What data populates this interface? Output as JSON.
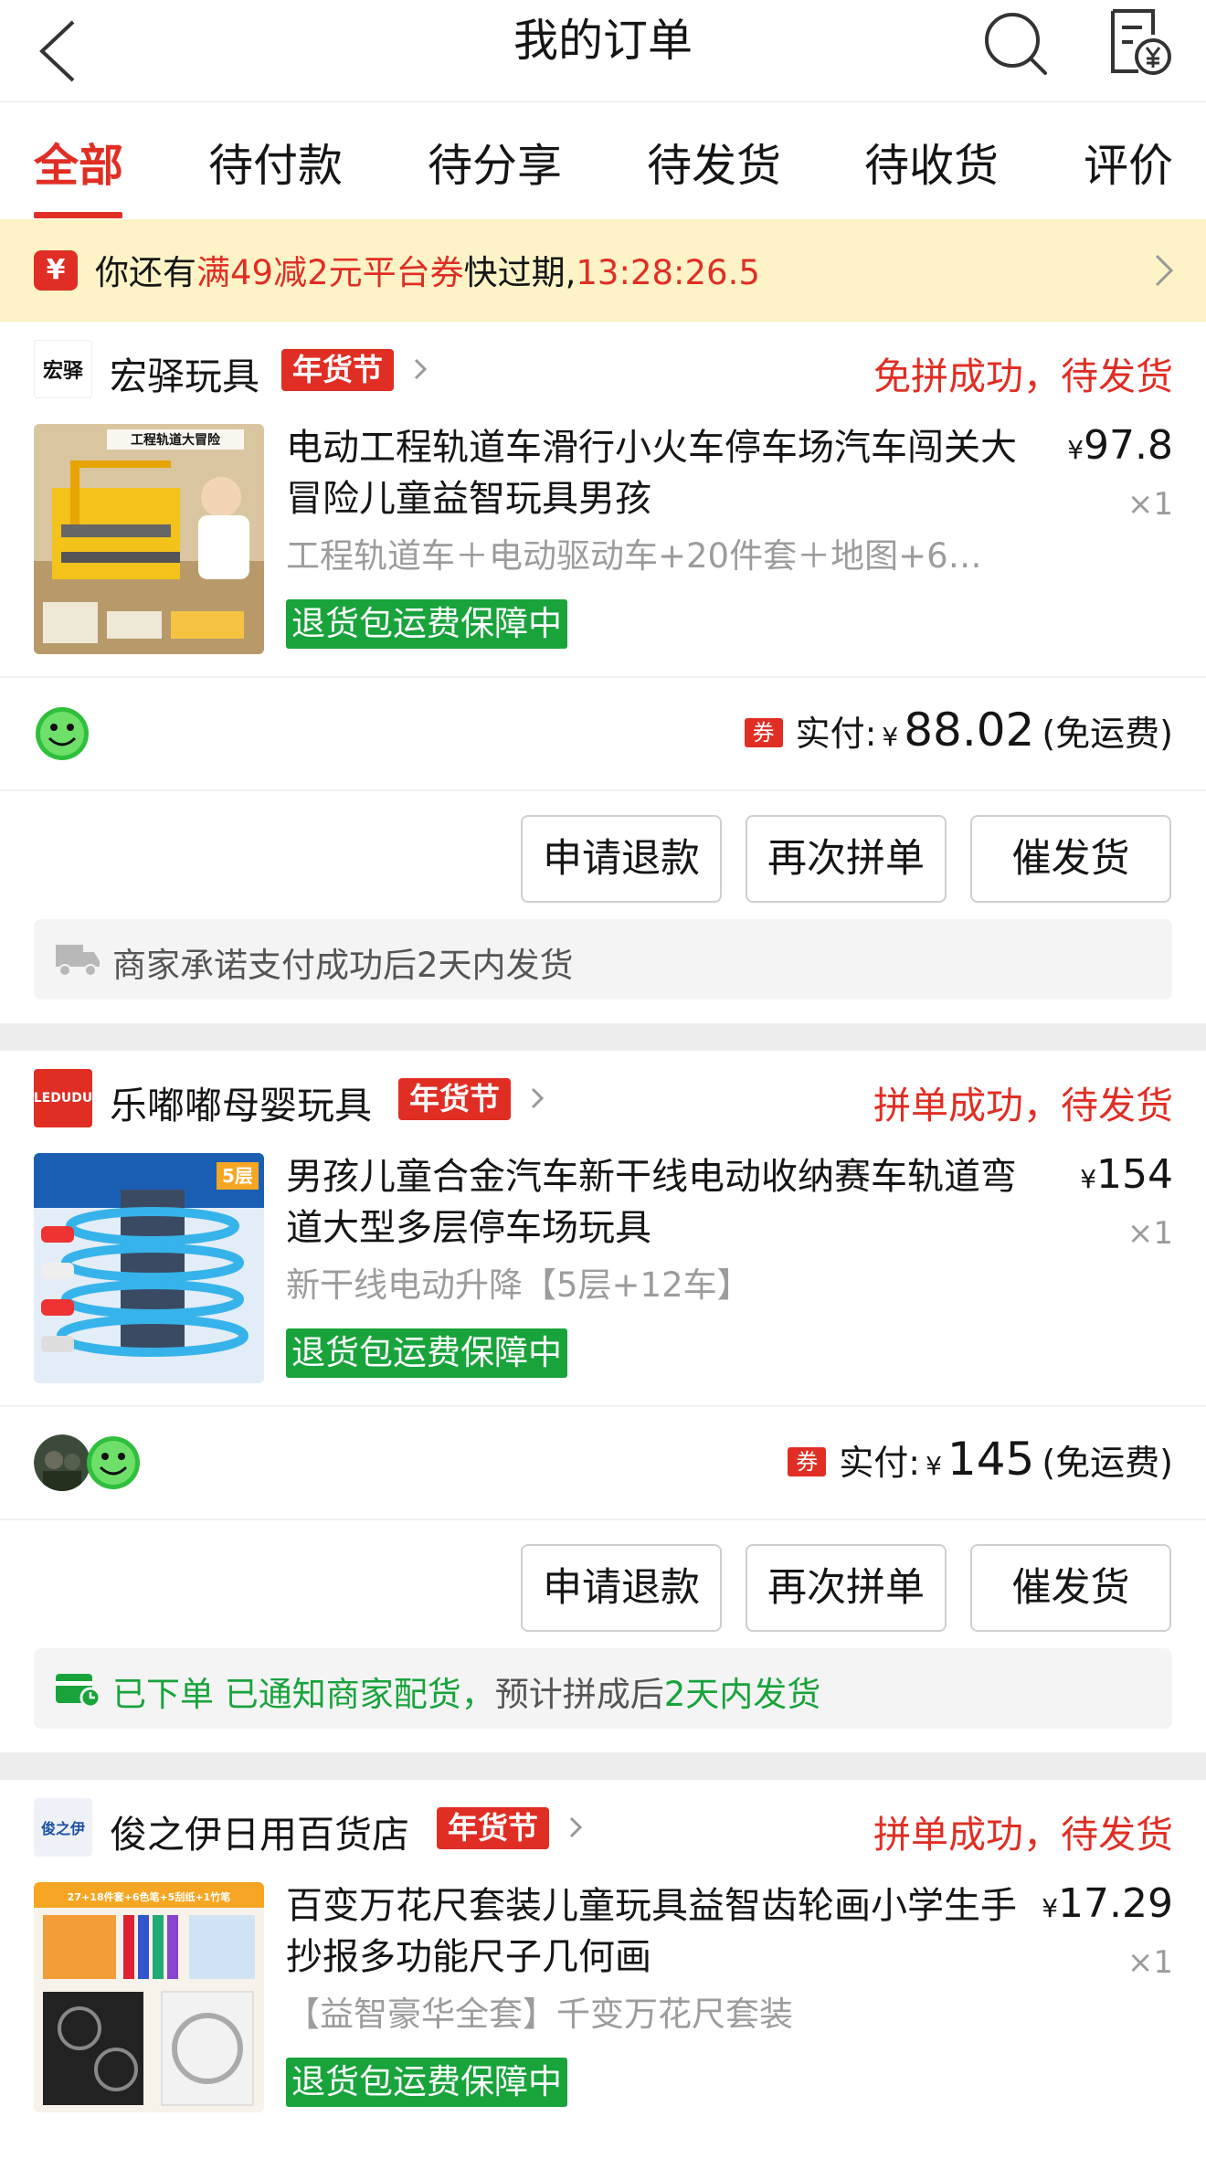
{
  "header": {
    "title": "我的订单"
  },
  "tabs": [
    {
      "label": "全部"
    },
    {
      "label": "待付款"
    },
    {
      "label": "待分享"
    },
    {
      "label": "待发货"
    },
    {
      "label": "待收货"
    },
    {
      "label": "评价"
    }
  ],
  "notice": {
    "prefix": "你还有",
    "highlight": "满49减2元平台券",
    "middle": "快过期,",
    "countdown": "13:28:26.5"
  },
  "orders": [
    {
      "shop_logo_text": "宏驿",
      "shop_name": "宏驿玩具",
      "badge": "年货节",
      "status": "免拼成功，待发货",
      "product_title": "电动工程轨道车滑行小火车停车场汽车闯关大冒险儿童益智玩具男孩",
      "spec": "工程轨道车＋电动驱动车+20件套＋地图+6…",
      "guarantee": "退货包运费保障中",
      "price_symbol": "¥",
      "price": "97.8",
      "qty": "×1",
      "coupon_icon": "券",
      "paid_label": "实付:",
      "paid_symbol": "¥",
      "paid_amount": "88.02",
      "shipping_note": "(免运费)",
      "buttons": {
        "refund": "申请退款",
        "regroup": "再次拼单",
        "urge": "催发货"
      },
      "info_text": "商家承诺支付成功后2天内发货",
      "img_caption": "工程轨道大冒险"
    },
    {
      "shop_logo_text": "LEDUDU",
      "shop_name": "乐嘟嘟母婴玩具",
      "badge": "年货节",
      "status": "拼单成功，待发货",
      "product_title": "男孩儿童合金汽车新干线电动收纳赛车轨道弯道大型多层停车场玩具",
      "spec": "新干线电动升降【5层+12车】",
      "guarantee": "退货包运费保障中",
      "price_symbol": "¥",
      "price": "154",
      "qty": "×1",
      "coupon_icon": "券",
      "paid_label": "实付:",
      "paid_symbol": "¥",
      "paid_amount": "145",
      "shipping_note": "(免运费)",
      "buttons": {
        "refund": "申请退款",
        "regroup": "再次拼单",
        "urge": "催发货"
      },
      "info_a": "已下单 已通知商家配货，",
      "info_b": "预计拼成后",
      "info_c": "2天内发货",
      "img_caption": "5层"
    },
    {
      "shop_logo_text": "俊之伊",
      "shop_name": "俊之伊日用百货店",
      "badge": "年货节",
      "status": "拼单成功，待发货",
      "product_title": "百变万花尺套装儿童玩具益智齿轮画小学生手抄报多功能尺子几何画",
      "spec": "【益智豪华全套】千变万花尺套装",
      "guarantee": "退货包运费保障中",
      "price_symbol": "¥",
      "price": "17.29",
      "qty": "×1",
      "img_caption": "27+18件套+6色笔+5刮纸+1竹笔"
    }
  ],
  "colors": {
    "accent": "#e02e24",
    "green": "#18a33b",
    "notice_bg": "#fdf3c6"
  }
}
